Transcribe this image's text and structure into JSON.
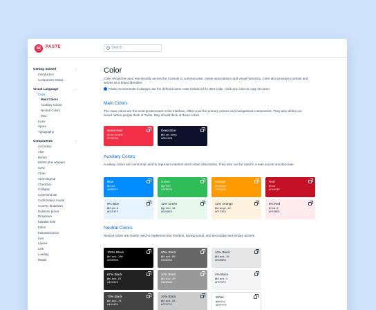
{
  "app": {
    "logo_letter": "ⓦ",
    "name": "PASTE"
  },
  "search": {
    "placeholder": "Search"
  },
  "sidebar": {
    "getting_started": {
      "label": "Getting Started",
      "items": [
        "Introduction",
        "Component Status"
      ]
    },
    "visual_language": {
      "label": "Visual Language",
      "color": "Color",
      "color_children": [
        "Main Colors",
        "Auxiliary Colors",
        "Neutral Colors",
        "Misc"
      ],
      "items": [
        "Icons",
        "Space",
        "Typography"
      ]
    },
    "components": {
      "label": "Components",
      "items": [
        "Accordion",
        "Alert",
        "Button",
        "Button plus wrapper",
        "Card",
        "Chart",
        "Chart legend",
        "Checkbox",
        "Collapse",
        "Command bar",
        "Confirmation modal",
        "Country dropdown",
        "Datetime picker",
        "Dropdown",
        "Editable field",
        "Editor",
        "Estimated price",
        "Icon",
        "Layout",
        "Link",
        "Loading",
        "Modal"
      ]
    }
  },
  "page": {
    "title": "Color",
    "intro": "Color should be used intentionally across the Console to communicate, create associations and visual hierarchy. Color also provides contrast and serves as a brand identifier.",
    "tip": "Paste recommends to always use the defined name color instead of its HEX code. Click any color to copy its name.",
    "main": {
      "title": "Main Colors",
      "desc": "The main colors are the most predominant in the interface. Often used for primary actions and navigational components. They also define our brand. When people think of Twilio, they should think of these colors."
    },
    "auxiliary": {
      "title": "Auxiliary Colors",
      "desc": "Auxiliary colors are commonly used to represent intention and create association. They also can be used to create accent and decorate."
    },
    "neutral": {
      "title": "Neutral Colors",
      "desc": "Neutral colors are mainly used to implement text, borders, backgrounds, and secondary and tertiary actions."
    }
  },
  "swatches": {
    "main": [
      {
        "name": "Brand Red",
        "token": "@red-brand",
        "hex": "#F22F46",
        "bg": "#f22f46",
        "tone": "dark"
      },
      {
        "name": "Deep Blue",
        "token": "@blue-deep",
        "hex": "#0D122B",
        "bg": "#0d122b",
        "tone": "dark"
      }
    ],
    "aux": [
      {
        "name": "Blue",
        "token": "@blue",
        "hex": "#008CFF",
        "bg": "#008cff",
        "tone": "dark"
      },
      {
        "name": "Green",
        "token": "@green",
        "hex": "#2EBD59",
        "bg": "#2ebd59",
        "tone": "dark"
      },
      {
        "name": "Orange",
        "token": "@orange",
        "hex": "#FF9A00",
        "bg": "#ff9a00",
        "tone": "dark"
      },
      {
        "name": "Red",
        "token": "@red",
        "hex": "#C41025",
        "bg": "#c41025",
        "tone": "dark"
      },
      {
        "name": "9% Blue",
        "token": "@blue-9",
        "hex": "#E5F3FF",
        "bg": "#e5f3ff",
        "tone": "light"
      },
      {
        "name": "12% Green",
        "token": "@green-12",
        "hex": "#E8F8ED",
        "bg": "#e8f8ed",
        "tone": "light"
      },
      {
        "name": "12% Orange",
        "token": "@orange-12",
        "hex": "#FFF3E0",
        "bg": "#fff3e0",
        "tone": "light"
      },
      {
        "name": "8% Red",
        "token": "@red-8",
        "hex": "#FFEBEE",
        "bg": "#ffebee",
        "tone": "light"
      }
    ],
    "neutral": [
      {
        "name": "100% Black",
        "token": "@black-100",
        "hex": "#000000",
        "bg": "#000000",
        "tone": "dark"
      },
      {
        "name": "60% Black",
        "token": "@black-60",
        "hex": "#666666",
        "bg": "#666666",
        "tone": "dark"
      },
      {
        "name": "10% Black",
        "token": "@black-10",
        "hex": "#E6E6E6",
        "bg": "#e6e6e6",
        "tone": "light"
      },
      {
        "name": "87% Black",
        "token": "@black-87",
        "hex": "#222222",
        "bg": "#222222",
        "tone": "dark"
      },
      {
        "name": "40% Black",
        "token": "@black-40",
        "hex": "#999999",
        "bg": "#999999",
        "tone": "dark"
      },
      {
        "name": "4% Black",
        "token": "@black-4",
        "hex": "#F5F5F5",
        "bg": "#f5f5f5",
        "tone": "light"
      },
      {
        "name": "73% Black",
        "token": "@black-73",
        "hex": "#444444",
        "bg": "#444444",
        "tone": "dark"
      },
      {
        "name": "20% Black",
        "token": "@black-20",
        "hex": "#CCCCCC",
        "bg": "#cccccc",
        "tone": "light"
      },
      {
        "name": "White",
        "token": "@white",
        "hex": "#FFFFFF",
        "bg": "#ffffff",
        "tone": "light"
      }
    ]
  },
  "colors": {
    "accent": "#0263E0",
    "brand": "#F22F46",
    "background": "#CFE3FB"
  }
}
